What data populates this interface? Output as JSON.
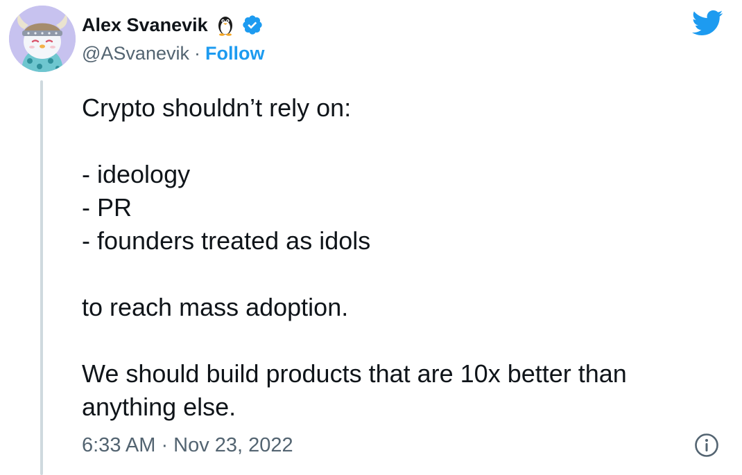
{
  "tweet": {
    "author": {
      "display_name": "Alex Svanevik",
      "handle": "@ASvanevik",
      "name_emoji": "penguin-icon",
      "verified": true,
      "avatar": "pudgy-penguin-viking-avatar"
    },
    "follow_label": "Follow",
    "separator": "·",
    "text": "Crypto shouldn’t rely on:\n\n- ideology\n- PR\n- founders treated as idols\n\nto reach mass adoption.\n\nWe should build products that are 10x better than anything else.",
    "timestamp": "6:33 AM · Nov 23, 2022"
  },
  "icons": {
    "brand": "twitter-bird-icon",
    "verified": "verified-badge-icon",
    "info": "info-icon"
  },
  "colors": {
    "accent": "#1d9bf0",
    "text_primary": "#0f1419",
    "text_secondary": "#536471",
    "thread_line": "#cfd9de"
  }
}
